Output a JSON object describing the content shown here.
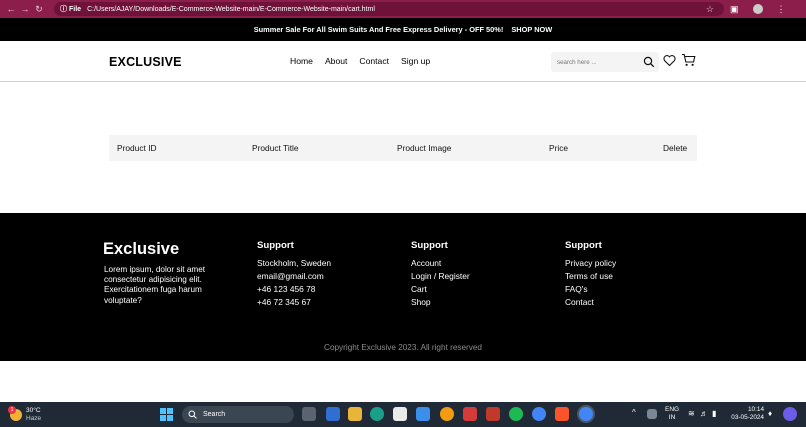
{
  "browser": {
    "file_chip": "File",
    "url": "C:/Users/AJAY/Downloads/E-Commerce-Website-main/E-Commerce-Website-main/cart.html"
  },
  "promo": {
    "text": "Summer Sale For All Swim Suits And Free Express Delivery - OFF 50%!",
    "cta": "SHOP NOW"
  },
  "header": {
    "logo": "EXCLUSIVE",
    "nav": [
      "Home",
      "About",
      "Contact",
      "Sign up"
    ],
    "search_placeholder": "search here ..."
  },
  "cart_table": {
    "columns": [
      "Product ID",
      "Product Title",
      "Product Image",
      "Price",
      "Delete"
    ]
  },
  "footer": {
    "brand": "Exclusive",
    "description": "Lorem ipsum, dolor sit amet consectetur adipisicing elit. Exercitationem fuga harum voluptate?",
    "col1": {
      "title": "Support",
      "items": [
        "Stockholm, Sweden",
        "email@gmail.com",
        "+46 123 456 78",
        "+46 72 345 67"
      ]
    },
    "col2": {
      "title": "Support",
      "items": [
        "Account",
        "Login / Register",
        "Cart",
        "Shop"
      ]
    },
    "col3": {
      "title": "Support",
      "items": [
        "Privacy policy",
        "Terms of use",
        "FAQ's",
        "Contact"
      ]
    },
    "copyright": "Copyright Exclusive 2023. All right reserved"
  },
  "taskbar": {
    "temperature": "30°C",
    "weather": "Haze",
    "weather_badge": "1",
    "search_label": "Search",
    "language": "ENG",
    "region": "IN",
    "time": "10:14",
    "date": "03-05-2024"
  },
  "colors": {
    "browser_bar": "#8b1e4b",
    "promo_bg": "#000000",
    "footer_bg": "#000000",
    "table_head_bg": "#f4f4f4",
    "taskbar_bg": "#1f2a36"
  }
}
